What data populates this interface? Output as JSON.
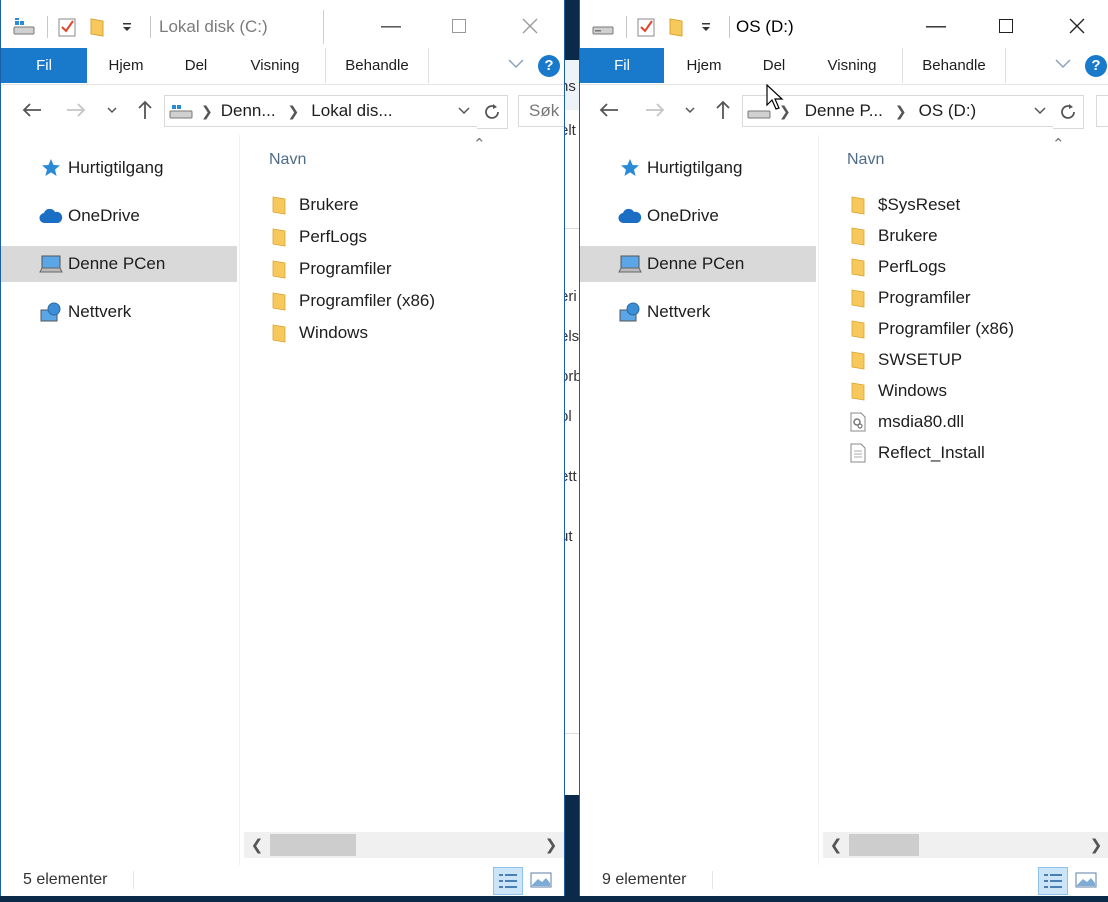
{
  "left_window": {
    "title": "Lokal disk (C:)",
    "tabs": [
      "Fil",
      "Hjem",
      "Del",
      "Visning",
      "Behandle"
    ],
    "help": "?",
    "address": [
      "Denn...",
      "Lokal dis..."
    ],
    "search_placeholder": "Søk",
    "nav_items": [
      "Hurtigtilgang",
      "OneDrive",
      "Denne PCen",
      "Nettverk"
    ],
    "selected_nav": "Denne PCen",
    "column_header": "Navn",
    "files": [
      {
        "name": "Brukere",
        "type": "folder"
      },
      {
        "name": "PerfLogs",
        "type": "folder"
      },
      {
        "name": "Programfiler",
        "type": "folder"
      },
      {
        "name": "Programfiler (x86)",
        "type": "folder"
      },
      {
        "name": "Windows",
        "type": "folder"
      }
    ],
    "status": "5 elementer"
  },
  "right_window": {
    "title": "OS (D:)",
    "tabs": [
      "Fil",
      "Hjem",
      "Del",
      "Visning",
      "Behandle"
    ],
    "help": "?",
    "address": [
      "Denne P...",
      "OS (D:)"
    ],
    "nav_items": [
      "Hurtigtilgang",
      "OneDrive",
      "Denne PCen",
      "Nettverk"
    ],
    "selected_nav": "Denne PCen",
    "column_header": "Navn",
    "files": [
      {
        "name": "$SysReset",
        "type": "folder"
      },
      {
        "name": "Brukere",
        "type": "folder"
      },
      {
        "name": "PerfLogs",
        "type": "folder"
      },
      {
        "name": "Programfiler",
        "type": "folder"
      },
      {
        "name": "Programfiler (x86)",
        "type": "folder"
      },
      {
        "name": "SWSETUP",
        "type": "folder"
      },
      {
        "name": "Windows",
        "type": "folder"
      },
      {
        "name": "msdia80.dll",
        "type": "dll"
      },
      {
        "name": "Reflect_Install",
        "type": "file"
      }
    ],
    "status": "9 elementer"
  },
  "background_fragments": [
    "ns",
    "elt",
    "eri",
    "els",
    "orb",
    "ol",
    "ett",
    "ut"
  ],
  "colors": {
    "accent": "#1979ca",
    "folder": "#f7c95c",
    "selected": "#d9d9d9",
    "header_text": "#4f6b8a"
  },
  "icons": [
    "drive-icon",
    "properties-icon",
    "folder-icon",
    "dropdown-icon",
    "back-icon",
    "forward-icon",
    "up-icon",
    "refresh-icon",
    "star-icon",
    "cloud-icon",
    "computer-icon",
    "network-icon",
    "details-view-icon",
    "large-icons-view-icon"
  ]
}
